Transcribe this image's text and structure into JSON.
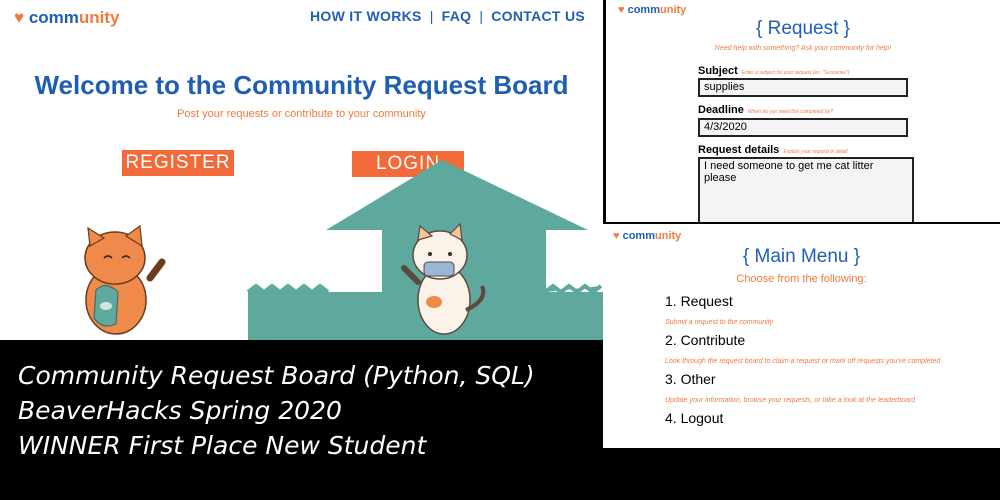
{
  "landing": {
    "logo": {
      "brand_plain": "comm",
      "brand_accent": "unity"
    },
    "nav": [
      "HOW IT WORKS",
      "|",
      "FAQ",
      "|",
      "CONTACT US"
    ],
    "title": "Welcome to the Community Request Board",
    "subtitle": "Post your requests or contribute to your community",
    "register_label": "REGISTER",
    "login_label": "LOGIN"
  },
  "request_form": {
    "logo": {
      "brand_plain": "comm",
      "brand_accent": "unity"
    },
    "heading": "{ Request }",
    "prompt": "Need help with something? Ask your community for help!",
    "subject_label": "Subject",
    "subject_hint": "Enter a subject for your request (ex. \"Groceries\")",
    "subject_value": "supplies",
    "deadline_label": "Deadline",
    "deadline_hint": "When do you need this completed by?",
    "deadline_value": "4/3/2020",
    "details_label": "Request details",
    "details_hint": "Explain your request in detail",
    "details_value": "I need someone to get me cat litter please"
  },
  "main_menu": {
    "logo": {
      "brand_plain": "comm",
      "brand_accent": "unity"
    },
    "heading": "{ Main Menu }",
    "prompt": "Choose from the following:",
    "items": [
      {
        "label": "1. Request",
        "desc": "Submit a request to the community"
      },
      {
        "label": "2. Contribute",
        "desc": "Look through the request board to claim a request or mark off requests you've completed"
      },
      {
        "label": "3. Other",
        "desc": "Update your information, browse your requests, or take a look at the leaderboard"
      },
      {
        "label": "4. Logout",
        "desc": ""
      }
    ]
  },
  "caption": {
    "line1": "Community Request Board (Python, SQL)",
    "line2": "BeaverHacks Spring 2020",
    "line3": "WINNER First Place New Student"
  },
  "colors": {
    "brand_blue": "#1f5fb3",
    "accent_orange": "#f07b3f",
    "button_orange": "#f26a3a",
    "house_teal": "#5fa89e",
    "cat_orange": "#f08a4b"
  }
}
